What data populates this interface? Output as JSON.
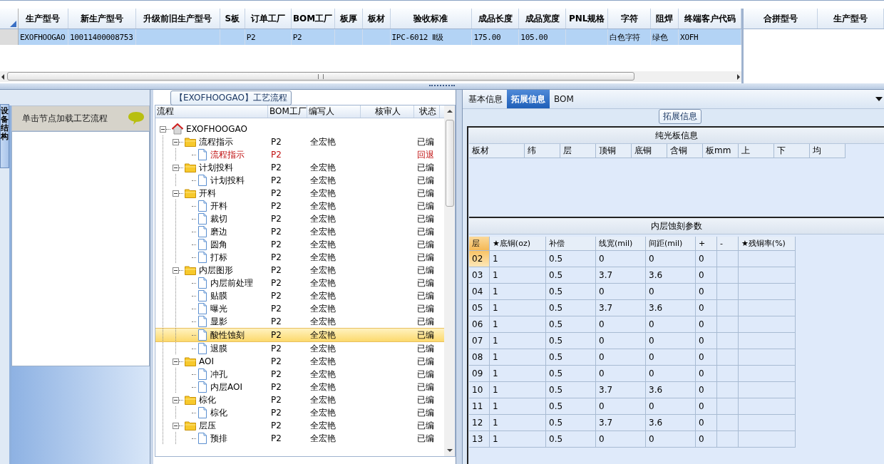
{
  "main_grid": {
    "columns": [
      "生产型号",
      "新生产型号",
      "升级前旧生产型号",
      "S板",
      "订单工厂",
      "BOM工厂",
      "板厚",
      "板材",
      "验收标准",
      "成品长度",
      "成品宽度",
      "PNL规格",
      "字符",
      "阻焊",
      "终端客户代码"
    ],
    "rows": [
      {
        "selected": true,
        "cells": [
          "EXOFHOOGAO",
          "10011400008753",
          "",
          "",
          "P2",
          "P2",
          "",
          "",
          "IPC-6012 Ⅱ级",
          "175.00",
          "105.00",
          "",
          "白色字符",
          "绿色",
          "XOFH"
        ]
      }
    ]
  },
  "merge_grid": {
    "columns": [
      "合拼型号",
      "生产型号"
    ]
  },
  "side_tab": {
    "label": "设备结构"
  },
  "hint_panel": {
    "title": "单击节点加载工艺流程"
  },
  "flow_group": {
    "title": "【EXOFHOOGAO】工艺流程"
  },
  "flow_tree": {
    "columns": [
      "流程",
      "BOM工厂",
      "编写人",
      "核审人",
      "状态"
    ],
    "nodes": [
      {
        "kind": "root",
        "name": "EXOFHOOGAO",
        "expanded": true,
        "selected": false,
        "flagged": false,
        "children": [
          {
            "kind": "folder",
            "name": "流程指示",
            "factory": "P2",
            "writer": "全宏艳",
            "status": "已编",
            "expanded": true,
            "selected": false,
            "flagged": false,
            "children": [
              {
                "kind": "file",
                "name": "流程指示",
                "factory": "P2",
                "status": "回退",
                "selected": false,
                "flagged": true
              }
            ]
          },
          {
            "kind": "folder",
            "name": "计划投料",
            "factory": "P2",
            "writer": "全宏艳",
            "status": "已编",
            "expanded": true,
            "selected": false,
            "flagged": false,
            "children": [
              {
                "kind": "file",
                "name": "计划投料",
                "factory": "P2",
                "writer": "全宏艳",
                "status": "已编",
                "selected": false,
                "flagged": false
              }
            ]
          },
          {
            "kind": "folder",
            "name": "开料",
            "factory": "P2",
            "writer": "全宏艳",
            "status": "已编",
            "expanded": true,
            "selected": false,
            "flagged": false,
            "children": [
              {
                "kind": "file",
                "name": "开料",
                "factory": "P2",
                "writer": "全宏艳",
                "status": "已编",
                "selected": false,
                "flagged": false
              },
              {
                "kind": "file",
                "name": "裁切",
                "factory": "P2",
                "writer": "全宏艳",
                "status": "已编",
                "selected": false,
                "flagged": false
              },
              {
                "kind": "file",
                "name": "磨边",
                "factory": "P2",
                "writer": "全宏艳",
                "status": "已编",
                "selected": false,
                "flagged": false
              },
              {
                "kind": "file",
                "name": "圆角",
                "factory": "P2",
                "writer": "全宏艳",
                "status": "已编",
                "selected": false,
                "flagged": false
              },
              {
                "kind": "file",
                "name": "打标",
                "factory": "P2",
                "writer": "全宏艳",
                "status": "已编",
                "selected": false,
                "flagged": false
              }
            ]
          },
          {
            "kind": "folder",
            "name": "内层图形",
            "factory": "P2",
            "writer": "全宏艳",
            "status": "已编",
            "expanded": true,
            "selected": false,
            "flagged": false,
            "children": [
              {
                "kind": "file",
                "name": "内层前处理",
                "factory": "P2",
                "writer": "全宏艳",
                "status": "已编",
                "selected": false,
                "flagged": false
              },
              {
                "kind": "file",
                "name": "贴膜",
                "factory": "P2",
                "writer": "全宏艳",
                "status": "已编",
                "selected": false,
                "flagged": false
              },
              {
                "kind": "file",
                "name": "曝光",
                "factory": "P2",
                "writer": "全宏艳",
                "status": "已编",
                "selected": false,
                "flagged": false
              },
              {
                "kind": "file",
                "name": "显影",
                "factory": "P2",
                "writer": "全宏艳",
                "status": "已编",
                "selected": false,
                "flagged": false
              },
              {
                "kind": "file",
                "name": "酸性蚀刻",
                "factory": "P2",
                "writer": "全宏艳",
                "status": "已编",
                "selected": true,
                "flagged": false
              },
              {
                "kind": "file",
                "name": "退膜",
                "factory": "P2",
                "writer": "全宏艳",
                "status": "已编",
                "selected": false,
                "flagged": false
              }
            ]
          },
          {
            "kind": "folder",
            "name": "AOI",
            "factory": "P2",
            "writer": "全宏艳",
            "status": "已编",
            "expanded": true,
            "selected": false,
            "flagged": false,
            "children": [
              {
                "kind": "file",
                "name": "冲孔",
                "factory": "P2",
                "writer": "全宏艳",
                "status": "已编",
                "selected": false,
                "flagged": false
              },
              {
                "kind": "file",
                "name": "内层AOI",
                "factory": "P2",
                "writer": "全宏艳",
                "status": "已编",
                "selected": false,
                "flagged": false
              }
            ]
          },
          {
            "kind": "folder",
            "name": "棕化",
            "factory": "P2",
            "writer": "全宏艳",
            "status": "已编",
            "expanded": true,
            "selected": false,
            "flagged": false,
            "children": [
              {
                "kind": "file",
                "name": "棕化",
                "factory": "P2",
                "writer": "全宏艳",
                "status": "已编",
                "selected": false,
                "flagged": false
              }
            ]
          },
          {
            "kind": "folder",
            "name": "层压",
            "factory": "P2",
            "writer": "全宏艳",
            "status": "已编",
            "expanded": true,
            "selected": false,
            "flagged": false,
            "children": [
              {
                "kind": "file",
                "name": "预排",
                "factory": "P2",
                "writer": "全宏艳",
                "status": "已编",
                "selected": false,
                "flagged": false
              }
            ]
          }
        ]
      }
    ]
  },
  "detail_tabs": [
    {
      "label": "基本信息",
      "selected": false
    },
    {
      "label": "拓展信息",
      "selected": true
    },
    {
      "label": "BOM",
      "selected": false
    }
  ],
  "detail_group": {
    "title": "拓展信息"
  },
  "plain_board": {
    "title": "纯光板信息",
    "columns": [
      "板材",
      "纬",
      "层",
      "顶铜",
      "底铜",
      "含铜",
      "板mm",
      "上",
      "下",
      "均"
    ]
  },
  "etching": {
    "title": "内层蚀刻参数",
    "columns": [
      "层",
      "★底铜(oz)",
      "补偿",
      "线宽(mil)",
      "间距(mil)",
      "+",
      "-",
      "★残铜率(%)"
    ],
    "rows": [
      {
        "selected": true,
        "cells": [
          "02",
          "1",
          "0.5",
          "0",
          "0",
          "0",
          "",
          ""
        ]
      },
      {
        "selected": false,
        "cells": [
          "03",
          "1",
          "0.5",
          "3.7",
          "3.6",
          "0",
          "",
          ""
        ]
      },
      {
        "selected": false,
        "cells": [
          "04",
          "1",
          "0.5",
          "0",
          "0",
          "0",
          "",
          ""
        ]
      },
      {
        "selected": false,
        "cells": [
          "05",
          "1",
          "0.5",
          "3.7",
          "3.6",
          "0",
          "",
          ""
        ]
      },
      {
        "selected": false,
        "cells": [
          "06",
          "1",
          "0.5",
          "0",
          "0",
          "0",
          "",
          ""
        ]
      },
      {
        "selected": false,
        "cells": [
          "07",
          "1",
          "0.5",
          "0",
          "0",
          "0",
          "",
          ""
        ]
      },
      {
        "selected": false,
        "cells": [
          "08",
          "1",
          "0.5",
          "0",
          "0",
          "0",
          "",
          ""
        ]
      },
      {
        "selected": false,
        "cells": [
          "09",
          "1",
          "0.5",
          "0",
          "0",
          "0",
          "",
          ""
        ]
      },
      {
        "selected": false,
        "cells": [
          "10",
          "1",
          "0.5",
          "3.7",
          "3.6",
          "0",
          "",
          ""
        ]
      },
      {
        "selected": false,
        "cells": [
          "11",
          "1",
          "0.5",
          "0",
          "0",
          "0",
          "",
          ""
        ]
      },
      {
        "selected": false,
        "cells": [
          "12",
          "1",
          "0.5",
          "3.7",
          "3.6",
          "0",
          "",
          ""
        ]
      },
      {
        "selected": false,
        "cells": [
          "13",
          "1",
          "0.5",
          "0",
          "0",
          "0",
          "",
          ""
        ]
      }
    ]
  }
}
